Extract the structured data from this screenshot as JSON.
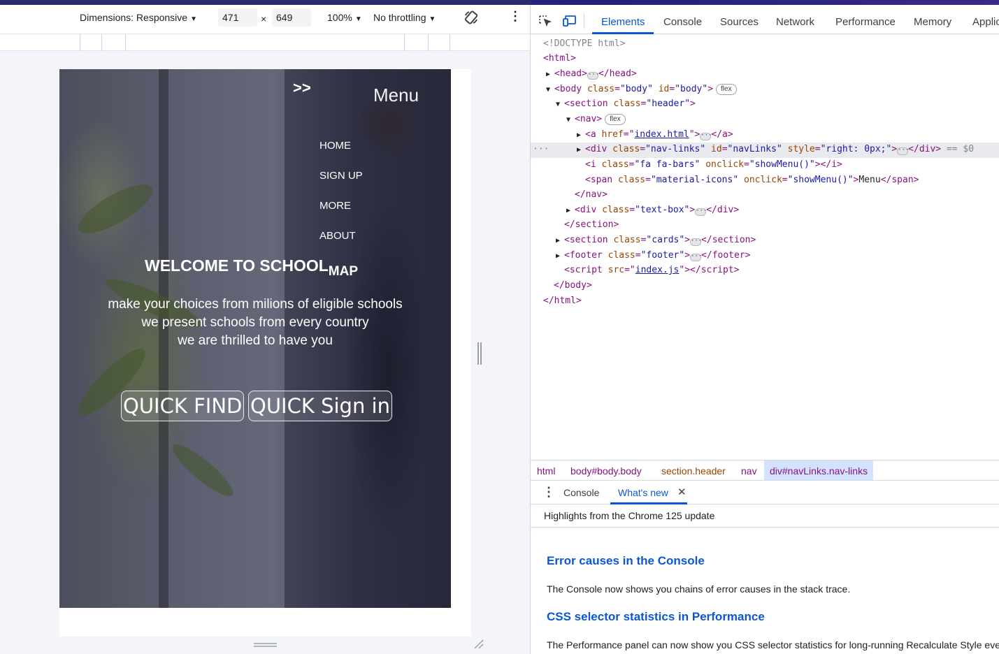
{
  "device_toolbar": {
    "dimensions_label": "Dimensions: Responsive",
    "width_value": "471",
    "times": "×",
    "height_value": "649",
    "zoom": "100%",
    "throttling": "No throttling"
  },
  "preview": {
    "nav_arrows": ">>",
    "menu_label": "Menu",
    "nav_links": [
      "HOME",
      "SIGN UP",
      "MORE",
      "ABOUT"
    ],
    "welcome_main": "WELCOME TO SCHOOL",
    "welcome_suffix": "MAP",
    "tagline": [
      "make your choices from milions of eligible schools",
      "we present schools from every country",
      "we are thrilled to have you"
    ],
    "quick_find": "QUICK FIND",
    "quick_signin": "QUICK Sign in"
  },
  "devtools": {
    "tabs": [
      "Elements",
      "Console",
      "Sources",
      "Network",
      "Performance",
      "Memory",
      "Applic"
    ],
    "active_tab": "Elements",
    "badges": {
      "flex": "flex",
      "dollar": "== $0"
    },
    "code": {
      "doctype": "<!DOCTYPE html>",
      "html_open": "<html>",
      "head_open": "<head>",
      "head_close": "</head>",
      "body_tag": "body",
      "body_class_val": "\"body\"",
      "body_id_val": "\"body\"",
      "section_class_val": "\"header\"",
      "nav_open": "<nav>",
      "a_href_val": "index.html",
      "div_class_val": "\"nav-links\"",
      "div_id_val": "\"navLinks\"",
      "div_style_val": "\"right: 0px;\"",
      "i_class_val": "\"fa fa-bars\"",
      "onclick_val": "\"showMenu()\"",
      "span_class_val": "\"material-icons\"",
      "span_text": "Menu",
      "nav_close": "</nav>",
      "textbox_class_val": "\"text-box\"",
      "section_close": "</section>",
      "cards_class_val": "\"cards\"",
      "footer_class_val": "\"footer\"",
      "script_src_val": "index.js",
      "body_close": "</body>",
      "html_close": "</html>"
    },
    "breadcrumbs": [
      "html",
      "body#body.body",
      "section.header",
      "nav",
      "div#navLinks.nav-links"
    ],
    "drawer_tabs": [
      "Console",
      "What's new"
    ],
    "drawer_active": "What's new",
    "highlights": "Highlights from the Chrome 125 update",
    "whats_new": [
      {
        "title": "Error causes in the Console",
        "text": "The Console now shows you chains of error causes in the stack trace."
      },
      {
        "title": "CSS selector statistics in Performance",
        "text": "The Performance panel can now show you CSS selector statistics for long-running Recalculate Style events."
      }
    ]
  },
  "colors": {
    "accent": "#0b57d0",
    "tag": "#881280",
    "attr_name": "#994500",
    "attr_value": "#1a1aa6"
  }
}
